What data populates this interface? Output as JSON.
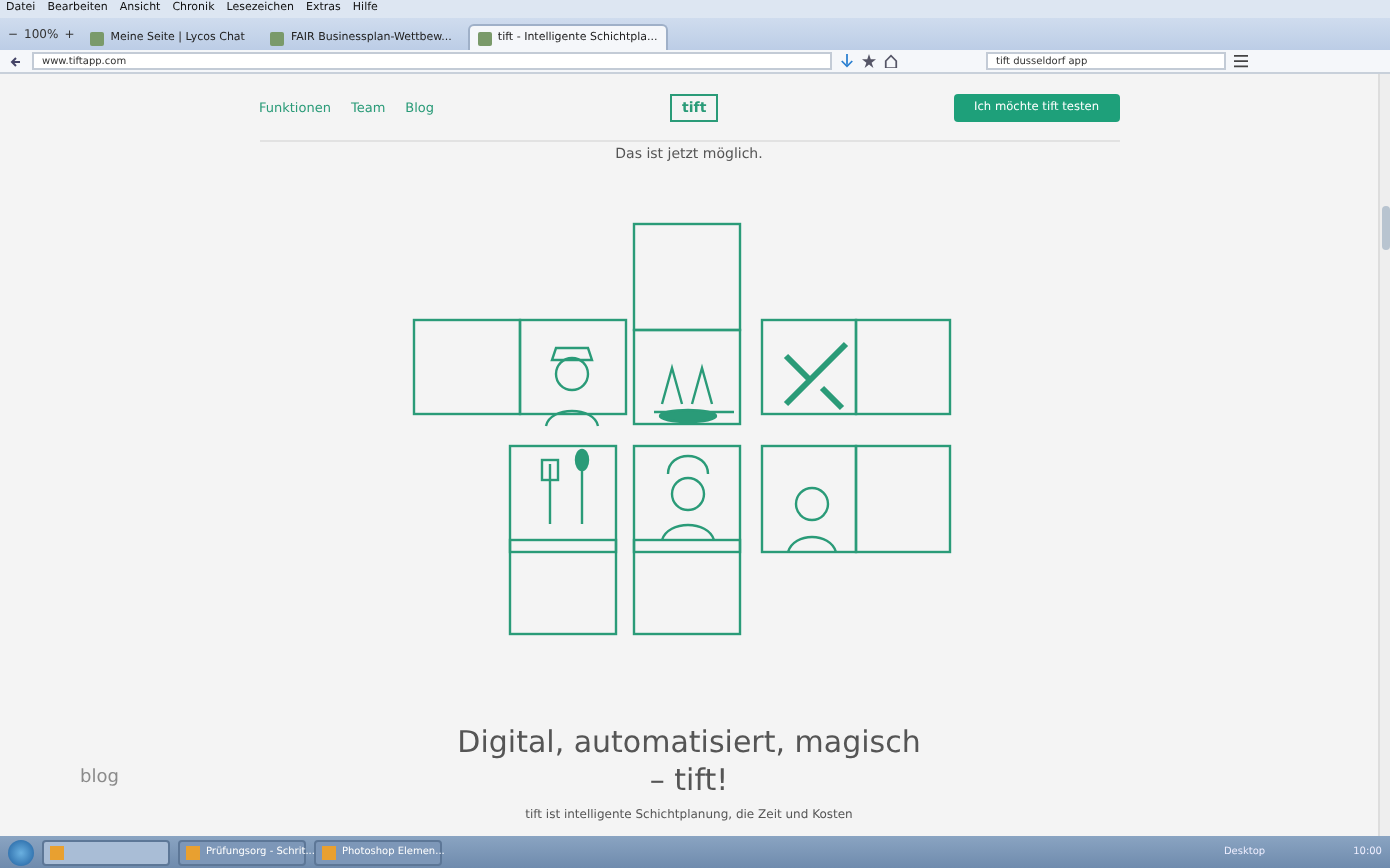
{
  "menu_bar": [
    "Datei",
    "Bearbeiten",
    "Ansicht",
    "Chronik",
    "Lesezeichen",
    "Extras",
    "Hilfe"
  ],
  "zoom": {
    "minus": "−",
    "value": "100%",
    "plus": "+"
  },
  "tabs": [
    {
      "label": "Meine Seite | Lycos Chat",
      "selected": false
    },
    {
      "label": "FAIR Businessplan-Wettbew...",
      "selected": false
    },
    {
      "label": "tift - Intelligente Schichtpla...",
      "selected": true
    }
  ],
  "address": {
    "value": "www.tiftapp.com"
  },
  "search": {
    "value": "tift dusseldorf app"
  },
  "site_nav": {
    "links": [
      "Funktionen",
      "Team",
      "Blog"
    ],
    "logo": "tift",
    "cta": "Ich möchte tift testen"
  },
  "intro": "Das ist jetzt möglich.",
  "heading": [
    "Digital, automatisiert, magisch",
    "– tift!"
  ],
  "body_text": "tift ist intelligente Schichtplanung, die Zeit und Kosten",
  "side_label": "blog",
  "taskbar": {
    "windows": [
      {
        "selected": true
      },
      {
        "label": "Prüfungsorg - Schrit...",
        "selected": false
      },
      {
        "label": "Photoshop Elemen...",
        "selected": false
      }
    ],
    "tray_label": "Desktop",
    "clock": "10:00"
  }
}
